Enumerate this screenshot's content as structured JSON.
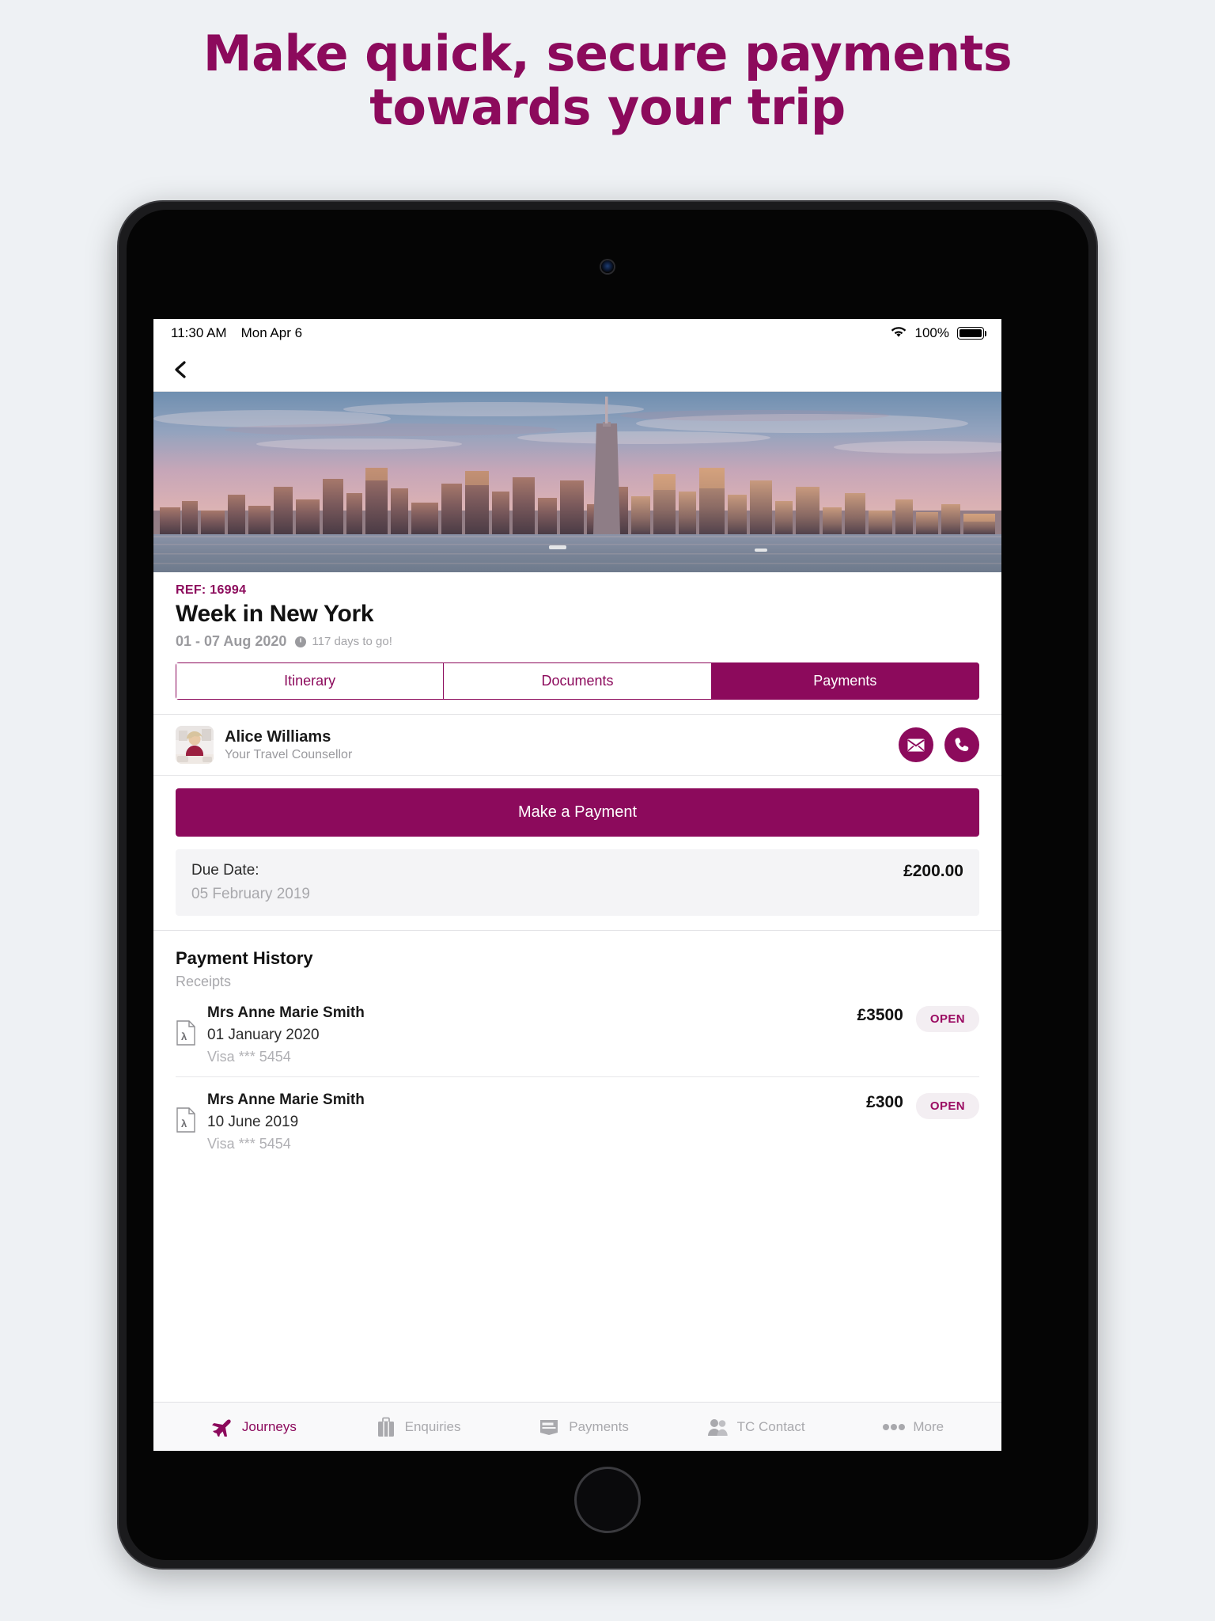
{
  "promo": {
    "headline_line1": "Make quick, secure payments",
    "headline_line2": "towards your trip",
    "accent_color": "#8c0a5c"
  },
  "statusbar": {
    "time": "11:30 AM",
    "date": "Mon Apr 6",
    "battery_percent": "100%",
    "wifi_icon": "wifi-icon",
    "battery_icon": "battery-full-icon"
  },
  "navbar": {
    "back_icon": "chevron-left-icon"
  },
  "hero": {
    "image_alt": "New York City skyline at sunset"
  },
  "trip": {
    "ref": "REF: 16994",
    "title": "Week in New York",
    "dates": "01 - 07 Aug 2020",
    "countdown": "117 days to go!",
    "countdown_icon": "clock-icon"
  },
  "tabs": [
    {
      "label": "Itinerary",
      "active": false
    },
    {
      "label": "Documents",
      "active": false
    },
    {
      "label": "Payments",
      "active": true
    }
  ],
  "counsellor": {
    "name": "Alice Williams",
    "role": "Your Travel Counsellor",
    "avatar_icon": "avatar-photo",
    "email_icon": "envelope-icon",
    "phone_icon": "phone-icon"
  },
  "payment": {
    "make_payment_label": "Make a Payment",
    "due_label": "Due Date:",
    "due_date": "05 February 2019",
    "due_amount": "£200.00"
  },
  "history": {
    "title": "Payment History",
    "subtitle": "Receipts",
    "receipts": [
      {
        "name": "Mrs Anne Marie Smith",
        "date": "01 January 2020",
        "card": "Visa *** 5454",
        "amount": "£3500",
        "action": "OPEN",
        "doc_icon": "pdf-icon"
      },
      {
        "name": "Mrs Anne Marie Smith",
        "date": "10 June 2019",
        "card": "Visa *** 5454",
        "amount": "£300",
        "action": "OPEN",
        "doc_icon": "pdf-icon"
      }
    ]
  },
  "tabbar": [
    {
      "label": "Journeys",
      "icon": "airplane-icon",
      "active": true
    },
    {
      "label": "Enquiries",
      "icon": "suitcase-icon",
      "active": false
    },
    {
      "label": "Payments",
      "icon": "credit-card-icon",
      "active": false
    },
    {
      "label": "TC Contact",
      "icon": "people-icon",
      "active": false
    },
    {
      "label": "More",
      "icon": "ellipsis-icon",
      "active": false
    }
  ]
}
